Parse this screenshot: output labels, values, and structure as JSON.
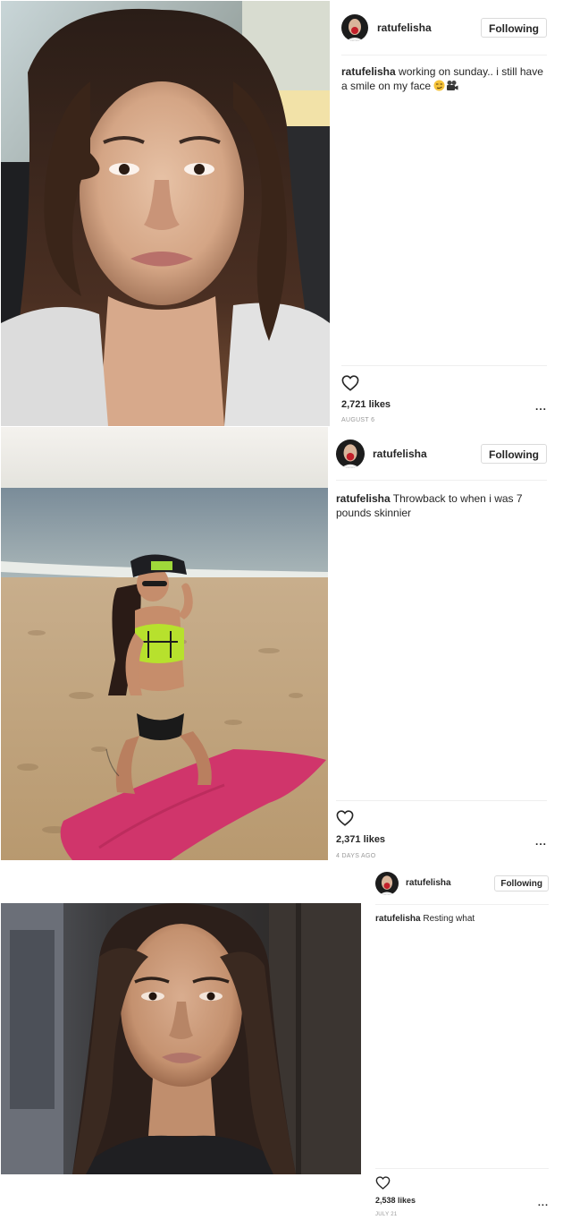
{
  "colors": {
    "border": "#efefef",
    "button_border": "#dbdbdb",
    "text": "#262626",
    "muted": "#999999"
  },
  "posts": [
    {
      "username": "ratufelisha",
      "follow_label": "Following",
      "caption_user": "ratufelisha",
      "caption_text": " working on sunday.. i still have a smile on my face ",
      "caption_emojis": [
        "smirk-emoji",
        "movie-camera-emoji"
      ],
      "likes": "2,721 likes",
      "date": "AUGUST 6",
      "more": "...",
      "photo": "selfie-in-car"
    },
    {
      "username": "ratufelisha",
      "follow_label": "Following",
      "caption_user": "ratufelisha",
      "caption_text": " Throwback to when i was 7 pounds skinnier",
      "likes": "2,371 likes",
      "date": "4 DAYS AGO",
      "more": "...",
      "photo": "beach-kneeling-on-pink-towel"
    },
    {
      "username": "ratufelisha",
      "follow_label": "Following",
      "caption_user": "ratufelisha",
      "caption_text": " Resting what",
      "likes": "2,538 likes",
      "date": "JULY 21",
      "more": "...",
      "photo": "portrait-dark-room"
    }
  ]
}
